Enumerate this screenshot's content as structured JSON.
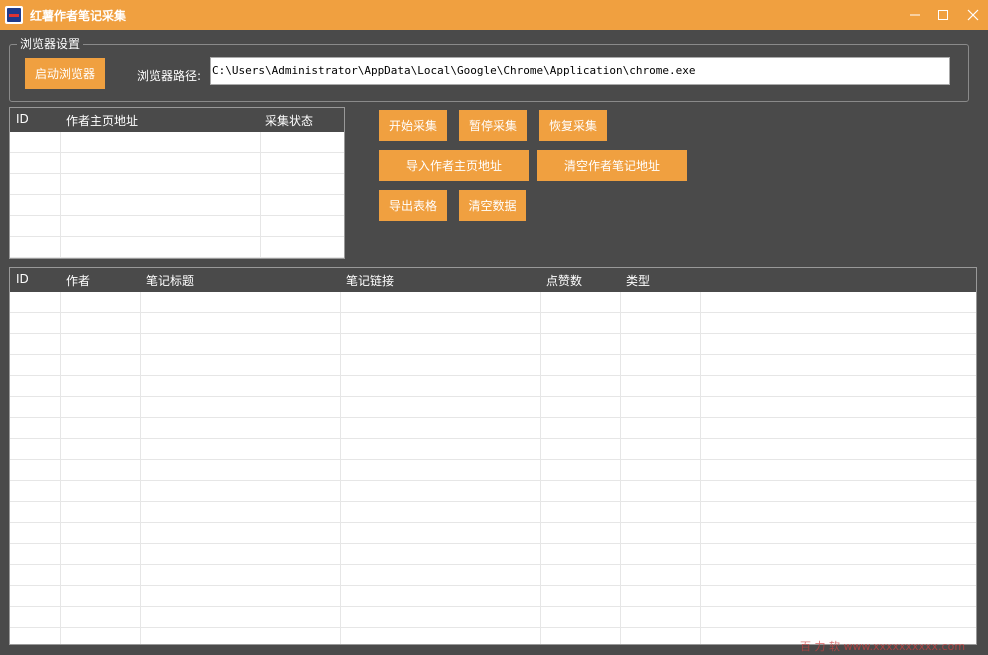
{
  "window": {
    "title": "红薯作者笔记采集",
    "controls": {
      "minimize": "minimize-icon",
      "maximize": "maximize-icon",
      "close": "close-icon"
    }
  },
  "browser_settings": {
    "group_title": "浏览器设置",
    "launch_button": "启动浏览器",
    "path_label": "浏览器路径:",
    "path_value": "C:\\Users\\Administrator\\AppData\\Local\\Google\\Chrome\\Application\\chrome.exe"
  },
  "author_table": {
    "columns": [
      "ID",
      "作者主页地址",
      "采集状态"
    ],
    "rows": []
  },
  "actions": {
    "start": "开始采集",
    "pause": "暂停采集",
    "resume": "恢复采集",
    "import_authors": "导入作者主页地址",
    "clear_author_notes": "清空作者笔记地址",
    "export_table": "导出表格",
    "clear_data": "清空数据"
  },
  "notes_table": {
    "columns": [
      "ID",
      "作者",
      "笔记标题",
      "笔记链接",
      "点赞数",
      "类型"
    ],
    "rows": []
  },
  "colors": {
    "accent": "#f0a040",
    "background": "#4a4a4a",
    "grid_bg": "#ffffff"
  },
  "watermark": "百 力 软  www.xxxxxxxxxx.com"
}
